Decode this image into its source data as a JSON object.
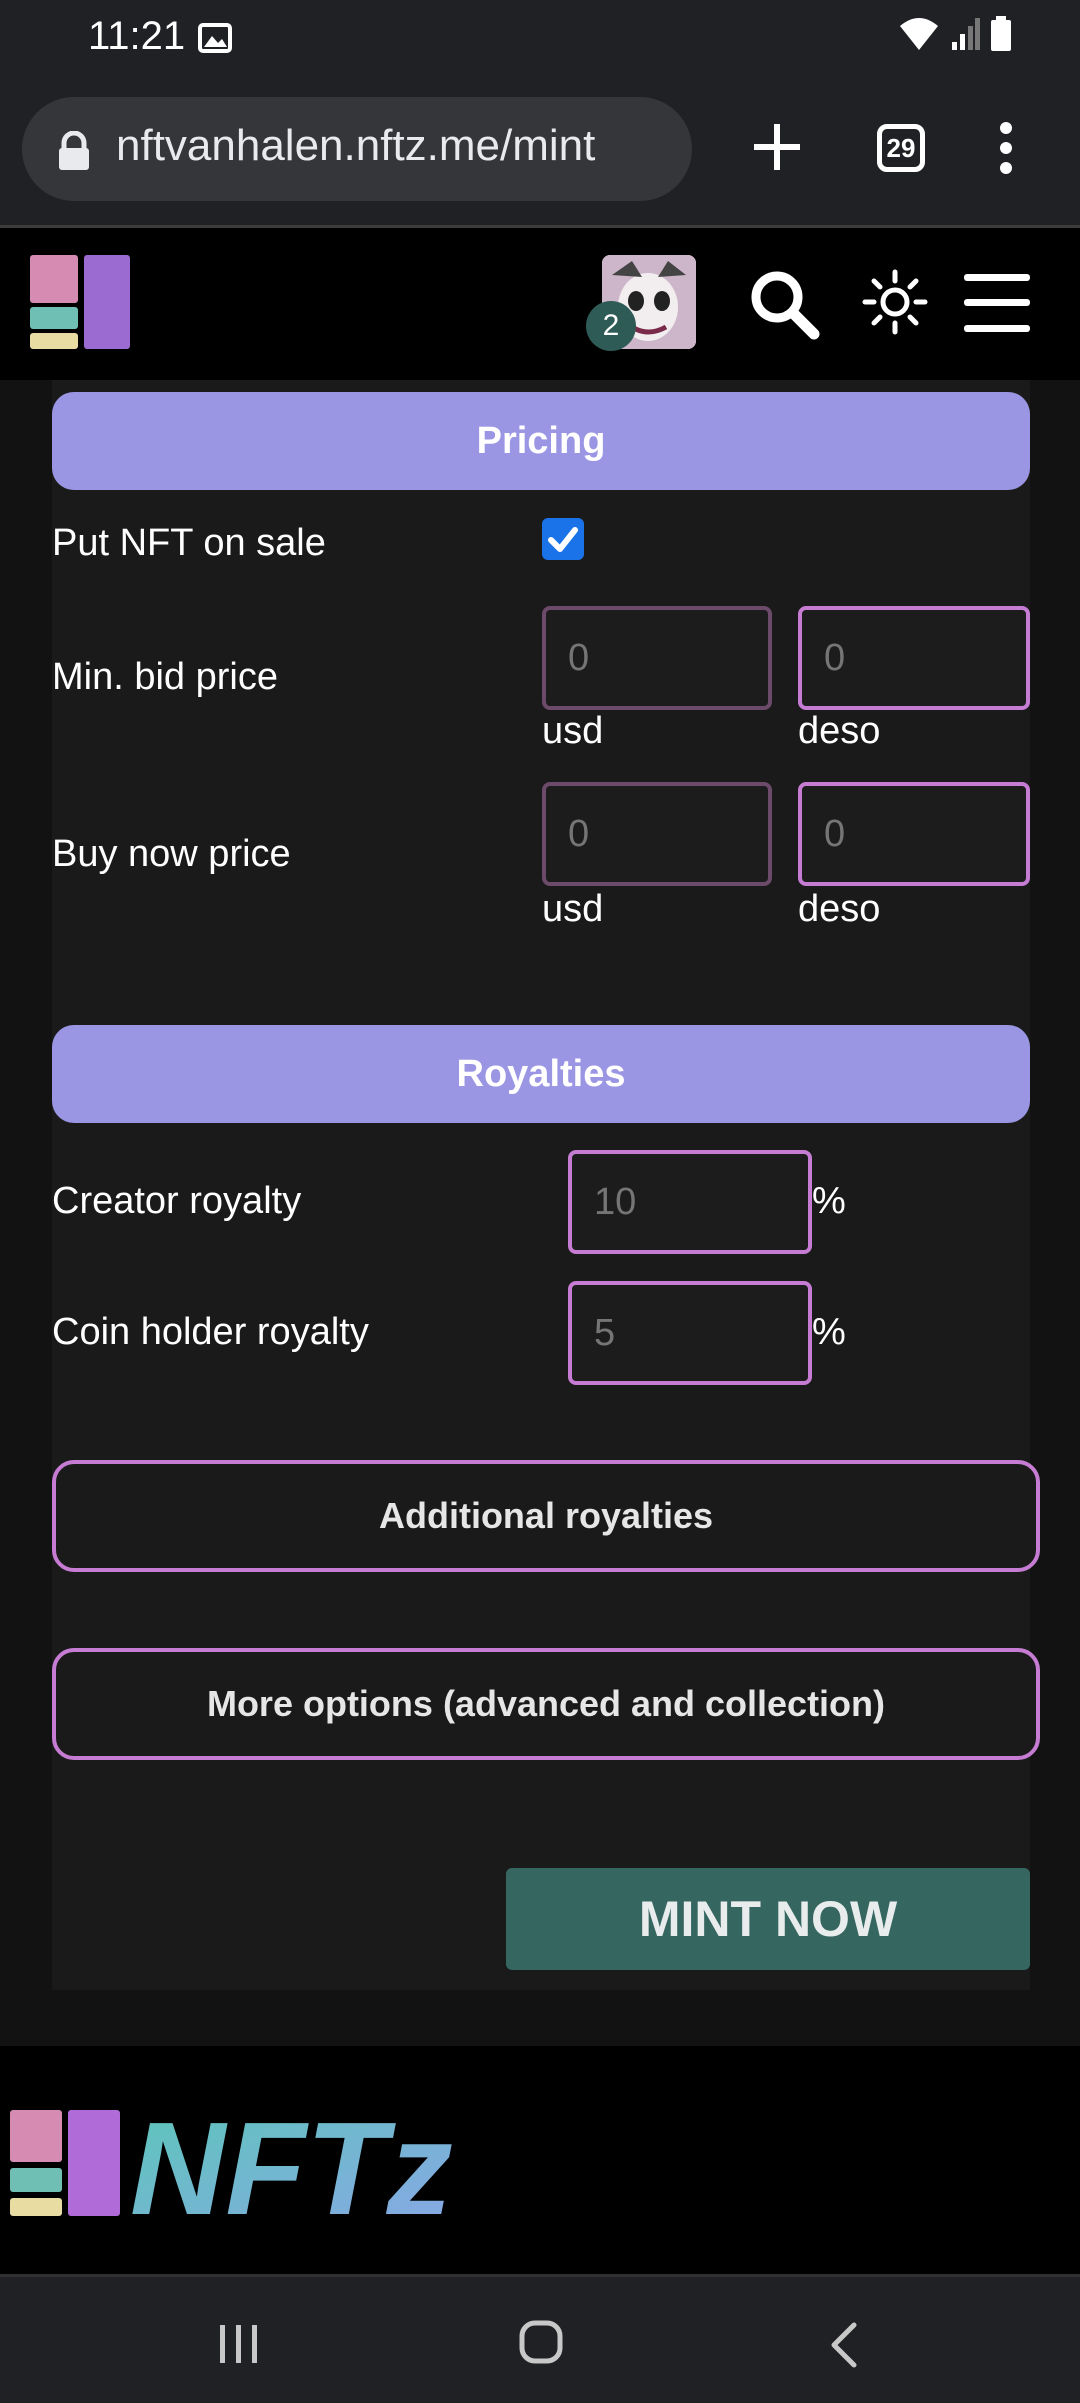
{
  "status_bar": {
    "time": "11:21"
  },
  "browser": {
    "url": "nftvanhalen.nftz.me/mint",
    "tab_count": "29"
  },
  "header": {
    "notification_count": "2"
  },
  "pricing": {
    "title": "Pricing",
    "put_on_sale_label": "Put NFT on sale",
    "put_on_sale_checked": true,
    "min_bid_label": "Min. bid price",
    "min_bid_usd_placeholder": "0",
    "min_bid_deso_placeholder": "0",
    "buy_now_label": "Buy now price",
    "buy_now_usd_placeholder": "0",
    "buy_now_deso_placeholder": "0",
    "unit_usd": "usd",
    "unit_deso": "deso"
  },
  "royalties": {
    "title": "Royalties",
    "creator_label": "Creator royalty",
    "creator_placeholder": "10",
    "coin_holder_label": "Coin holder royalty",
    "coin_holder_placeholder": "5",
    "percent": "%"
  },
  "buttons": {
    "additional_royalties": "Additional royalties",
    "more_options": "More options (advanced and collection)",
    "mint_now": "MINT NOW"
  },
  "footer": {
    "brand": "NFTz"
  },
  "colors": {
    "section_header": "#9b96e3",
    "field_border": "#c57cd2",
    "mint_button": "#366660"
  },
  "icons": [
    "gallery-icon",
    "wifi-icon",
    "signal-icon",
    "battery-icon",
    "lock-icon",
    "new-tab-icon",
    "tab-switcher-icon",
    "more-icon",
    "site-logo-icon",
    "search-icon",
    "theme-toggle-icon",
    "hamburger-menu-icon",
    "checkbox-checked-icon",
    "recents-icon",
    "home-icon",
    "back-icon"
  ]
}
